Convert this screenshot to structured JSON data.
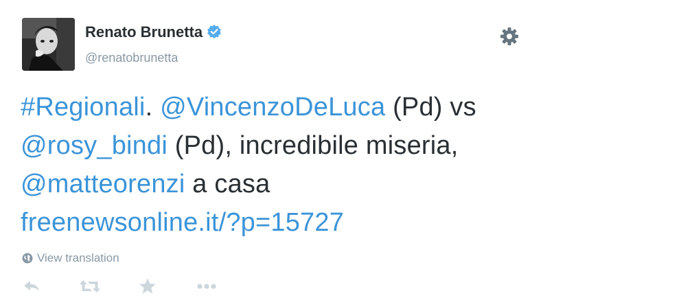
{
  "user": {
    "display_name": "Renato Brunetta",
    "handle": "@renatobrunetta",
    "verified": true,
    "avatar": "user-avatar-photo"
  },
  "tweet": {
    "hashtag": "#Regionali",
    "dot": ".",
    "mention1": "@VincenzoDeLuca",
    "text1": " (Pd) vs",
    "mention2": "@rosy_bindi",
    "text2": " (Pd), incredibile miseria,",
    "mention3": "@matteorenzi",
    "text3": " a casa",
    "link": "freenewsonline.it/?p=15727"
  },
  "translate": {
    "label": "View translation",
    "icon": "globe-icon"
  },
  "actions": {
    "icons": [
      "reply-icon",
      "retweet-icon",
      "favorite-icon",
      "more-icon"
    ]
  },
  "colors": {
    "link": "#3b94d9",
    "text": "#292f33",
    "muted": "#8899a6",
    "verified": "#55acee",
    "icon": "#ccd6dd"
  }
}
